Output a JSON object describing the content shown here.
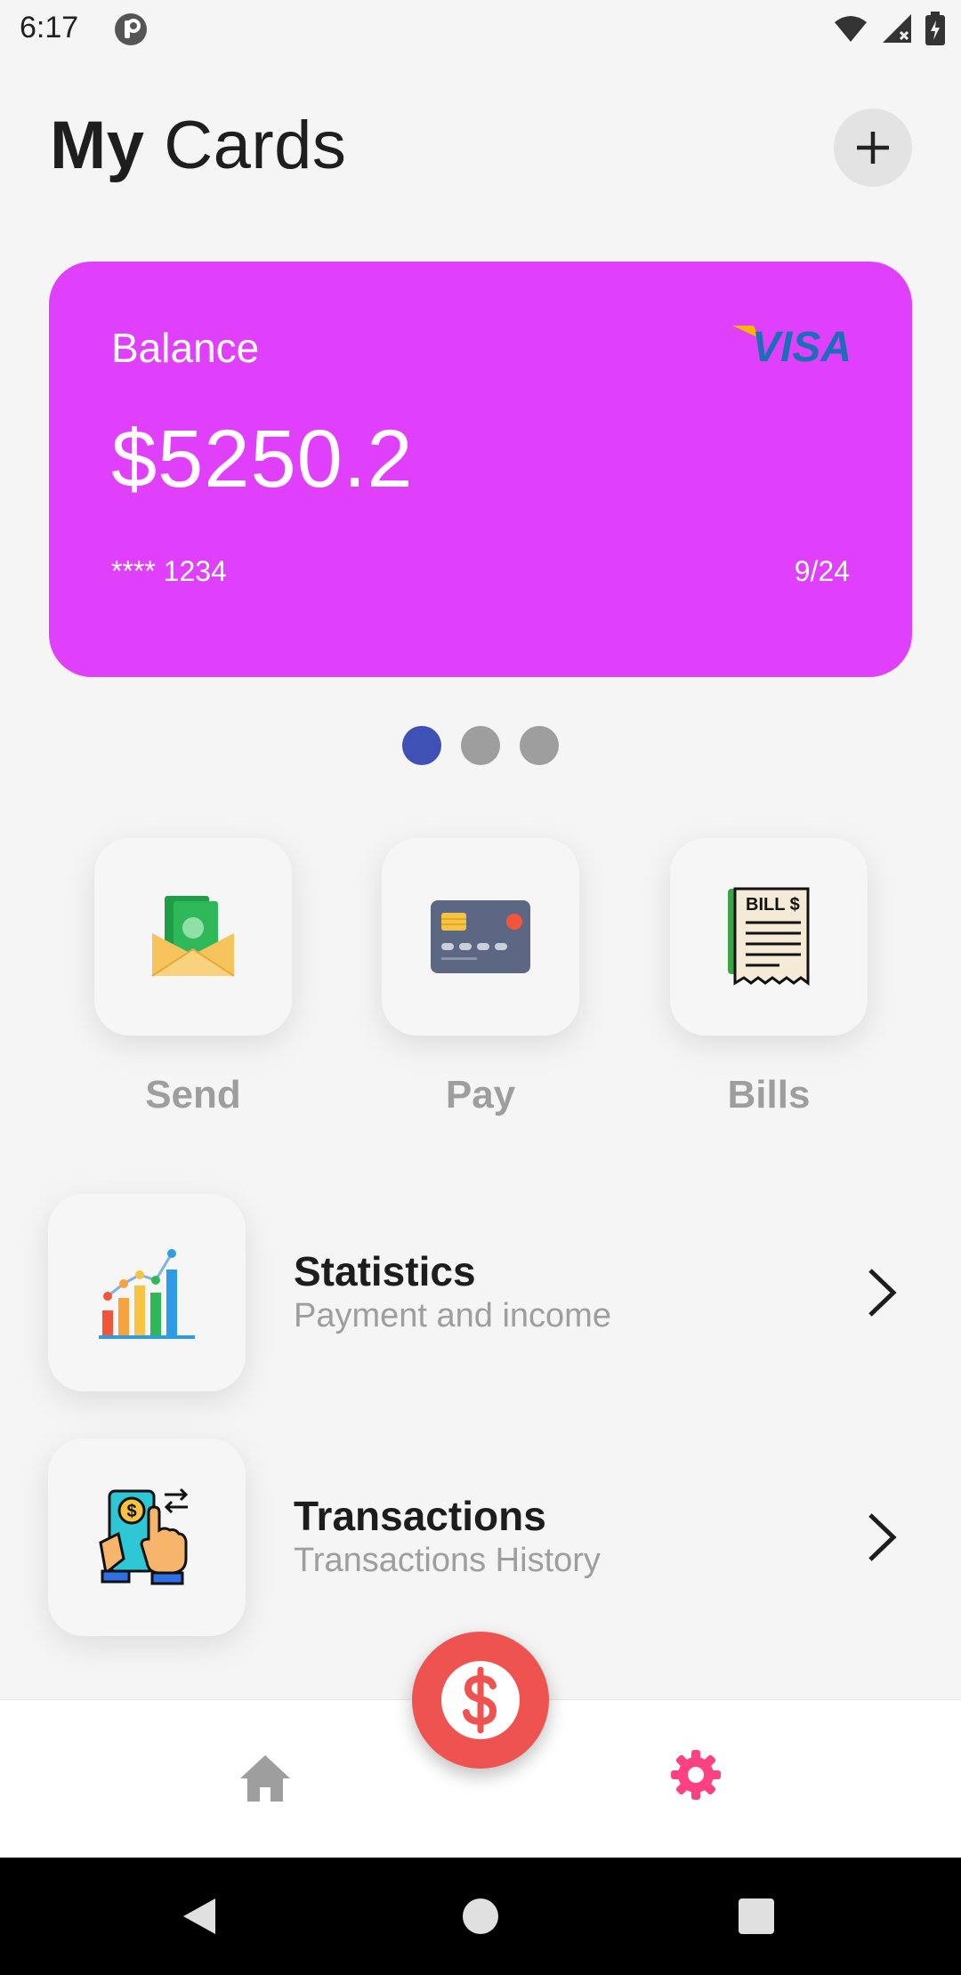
{
  "status_bar": {
    "time": "6:17"
  },
  "header": {
    "title_bold": "My",
    "title_regular": " Cards"
  },
  "card": {
    "balance_label": "Balance",
    "balance": "$5250.2",
    "number": "**** 1234",
    "expiry": "9/24",
    "brand": "VISA",
    "color": "#e040fb"
  },
  "pager": {
    "count": 3,
    "active_index": 0
  },
  "actions": [
    {
      "label": "Send",
      "icon": "money-envelope-icon"
    },
    {
      "label": "Pay",
      "icon": "credit-card-icon"
    },
    {
      "label": "Bills",
      "icon": "bill-icon"
    }
  ],
  "rows": [
    {
      "title": "Statistics",
      "subtitle": "Payment and income",
      "icon": "bar-chart-icon"
    },
    {
      "title": "Transactions",
      "subtitle": "Transactions History",
      "icon": "phone-payment-icon"
    }
  ],
  "bottom_nav": {
    "fab_icon": "dollar-icon",
    "accent": "#ef5350",
    "settings_color": "#ff4081"
  }
}
